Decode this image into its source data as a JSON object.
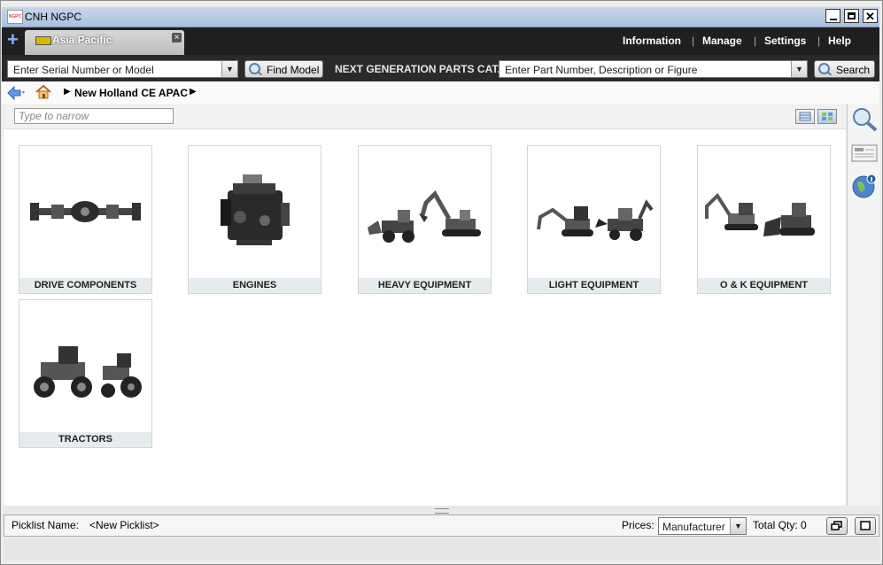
{
  "window": {
    "title": "CNH NGPC",
    "logo_text": "NGPC"
  },
  "tabs": {
    "add_label": "+",
    "active_label": "Asia Pacific",
    "close_label": "×"
  },
  "menu": [
    {
      "label": "Information"
    },
    {
      "label": "Manage"
    },
    {
      "label": "Settings"
    },
    {
      "label": "Help"
    }
  ],
  "search": {
    "model_placeholder": "Enter Serial Number or Model",
    "find_model_label": "Find Model",
    "catalog_title": "NEXT GENERATION PARTS CAT...",
    "part_placeholder": "Enter Part Number, Description or Figure",
    "search_label": "Search"
  },
  "breadcrumb": {
    "label": "New Holland CE APAC"
  },
  "filter": {
    "placeholder": "Type to narrow"
  },
  "categories": [
    {
      "label": "DRIVE COMPONENTS",
      "icon": "axle-icon"
    },
    {
      "label": "ENGINES",
      "icon": "engine-icon"
    },
    {
      "label": "HEAVY EQUIPMENT",
      "icon": "loader-excavator-icon"
    },
    {
      "label": "LIGHT EQUIPMENT",
      "icon": "mini-excavator-backhoe-icon"
    },
    {
      "label": "O & K EQUIPMENT",
      "icon": "excavator-dozer-icon"
    },
    {
      "label": "TRACTORS",
      "icon": "tractors-icon"
    }
  ],
  "picklist": {
    "name_label": "Picklist Name:",
    "name_value": "<New Picklist>",
    "prices_label": "Prices:",
    "prices_value": "Manufacturer",
    "total_qty_label": "Total Qty: 0"
  },
  "colors": {
    "accent": "#a9c1de",
    "dark_bar": "#1f1f1f",
    "card_caption": "#e6ecee"
  }
}
